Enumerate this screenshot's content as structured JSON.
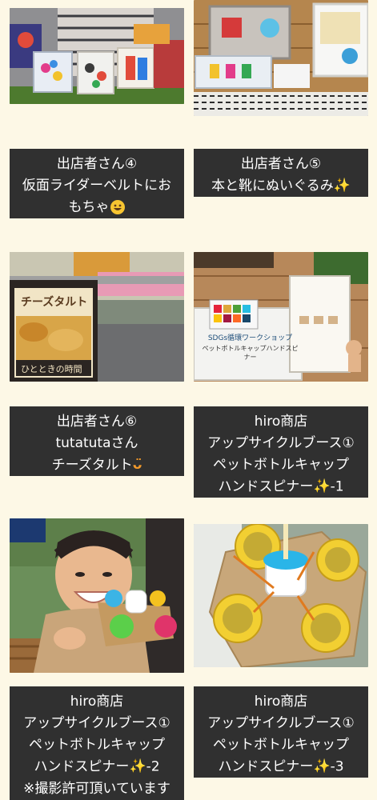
{
  "cards": [
    {
      "id": "vendor-4",
      "lines": [
        "出店者さん④",
        "仮面ライダーベルトにお",
        "もちゃ"
      ],
      "emoji": "smile",
      "photo": "toys-in-baskets-on-mat"
    },
    {
      "id": "vendor-5",
      "lines": [
        "出店者さん⑤",
        "本と靴にぬいぐるみ"
      ],
      "emoji": "sparkles",
      "photo": "baskets-on-wooden-deck"
    },
    {
      "id": "vendor-6",
      "lines": [
        "出店者さん⑥",
        "tutatutaさん",
        "チーズタルト"
      ],
      "emoji": "wink",
      "photo": "cheese-tart-sign-stall"
    },
    {
      "id": "hiro-1",
      "lines": [
        "hiro商店",
        "アップサイクルブース①",
        "ペットボトルキャップ",
        "ハンドスピナー",
        "-1"
      ],
      "emoji": "sparkles",
      "photo": "sdgs-workshop-signs"
    },
    {
      "id": "hiro-2",
      "lines": [
        "hiro商店",
        "アップサイクルブース①",
        "ペットボトルキャップ",
        "ハンドスピナー",
        "-2",
        "※撮影許可頂いています"
      ],
      "emoji": "sparkles",
      "photo": "boy-with-spinner"
    },
    {
      "id": "hiro-3",
      "lines": [
        "hiro商店",
        "アップサイクルブース①",
        "ペットボトルキャップ",
        "ハンドスピナー",
        "-3"
      ],
      "emoji": "sparkles",
      "photo": "bottle-cap-spinner-closeup"
    }
  ],
  "photo_texts": {
    "tart_sign": "チーズタルト",
    "tart_sign_bottom": "ひとときの時間",
    "workshop_title": "SDGs循環ワークショップ",
    "workshop_body": "ペットボトルキャップハンドスピナー"
  },
  "colors": {
    "background": "#fdf8e6",
    "caption_bg": "#303030",
    "caption_text": "#ffffff",
    "sparkle": "#f0c23a"
  }
}
